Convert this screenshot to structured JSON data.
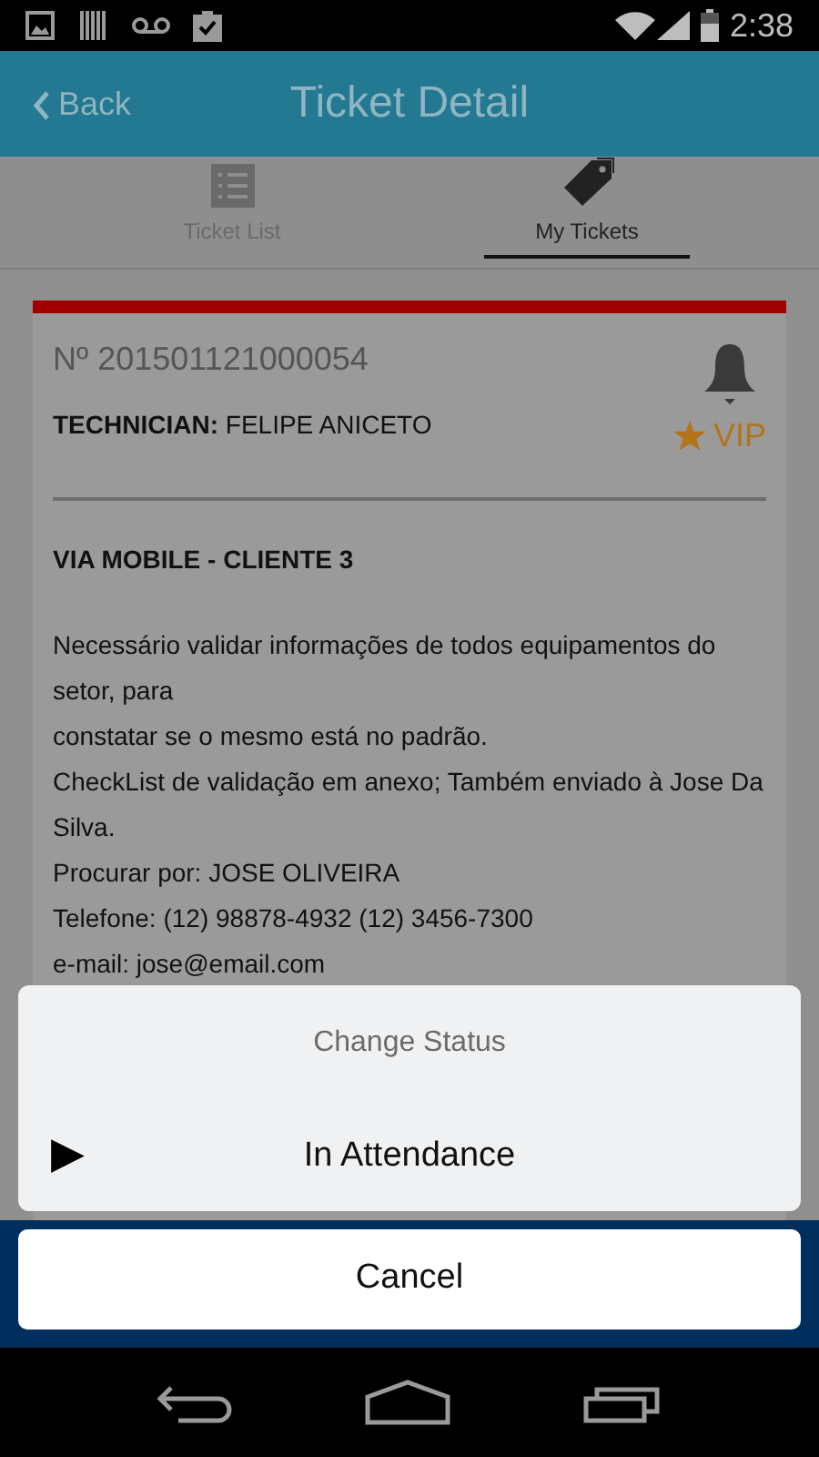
{
  "status_bar": {
    "time": "2:38"
  },
  "header": {
    "back": "Back",
    "title": "Ticket Detail"
  },
  "tabs": [
    {
      "label": "Ticket List",
      "selected": false
    },
    {
      "label": "My Tickets",
      "selected": true
    }
  ],
  "ticket": {
    "number": "Nº 201501121000054",
    "technician_label": "TECHNICIAN:",
    "technician": "FELIPE ANICETO",
    "vip": "VIP",
    "client": "VIA MOBILE - CLIENTE 3",
    "description": [
      "Necessário validar informações de todos equipamentos do setor, para",
      "constatar se o mesmo está no padrão.",
      "CheckList de validação em anexo; Também enviado à Jose Da Silva.",
      "Procurar por: JOSE OLIVEIRA",
      "Telefone: (12) 98878-4932 (12) 3456-7300",
      "e-mail: jose@email.com"
    ]
  },
  "action_sheet": {
    "title": "Change Status",
    "options": [
      {
        "icon": "▶",
        "label": "In Attendance"
      }
    ],
    "cancel": "Cancel"
  }
}
